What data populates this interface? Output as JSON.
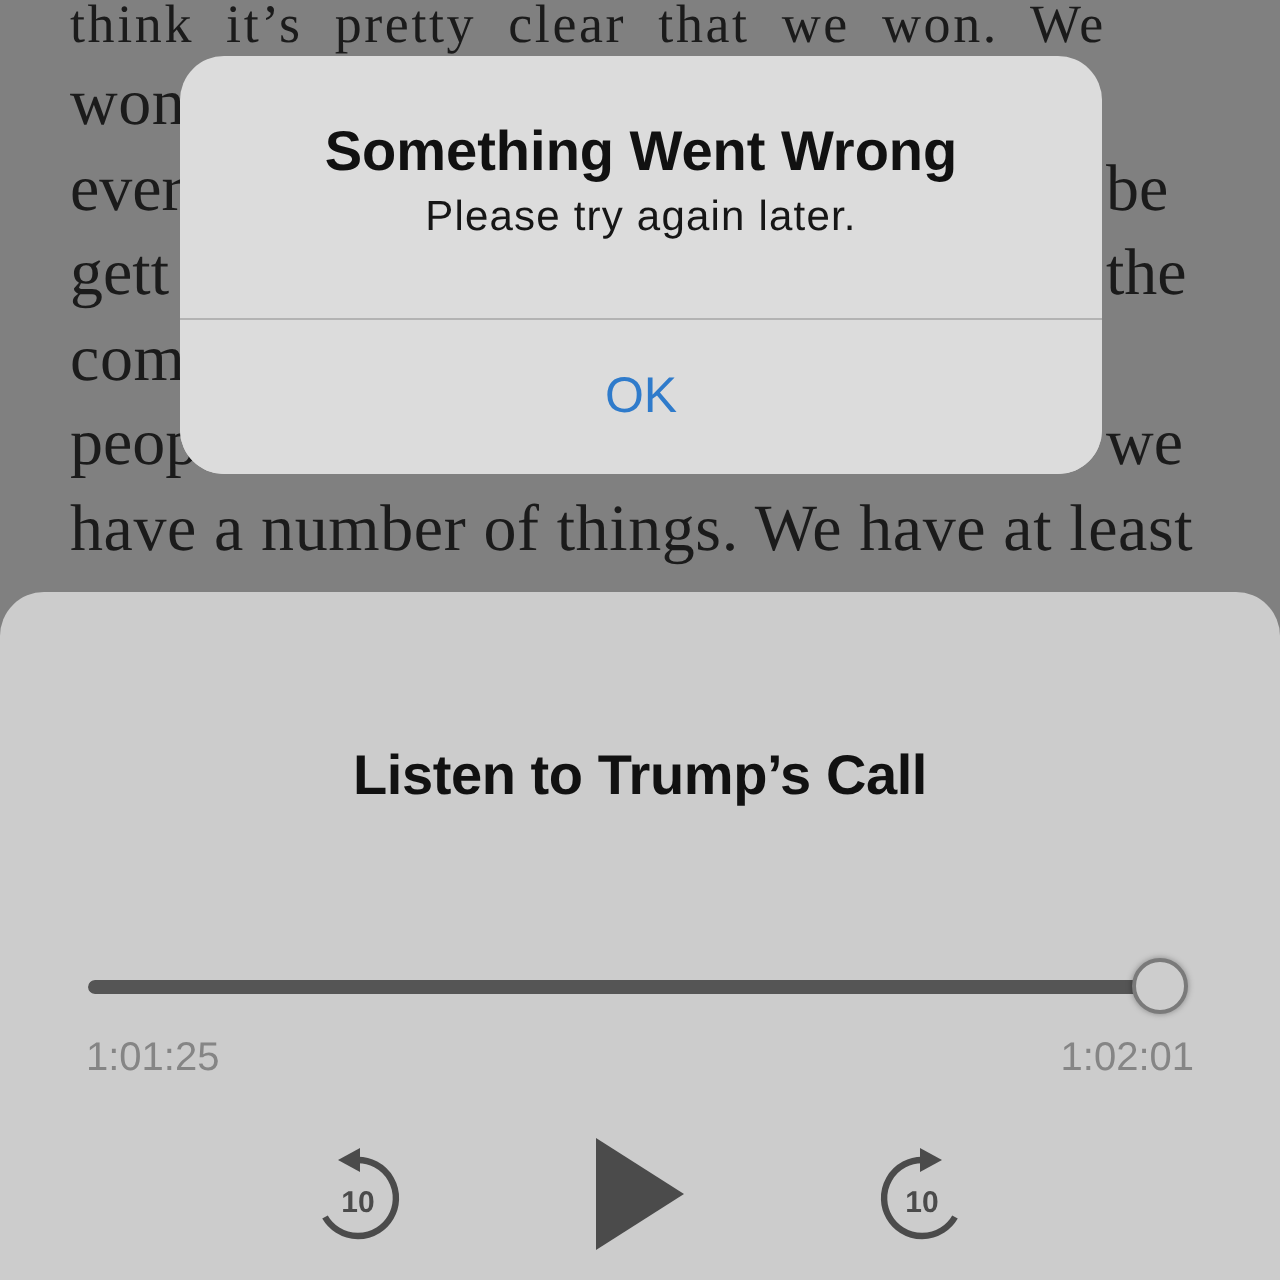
{
  "article": {
    "lines": [
      {
        "left": "think it’s pretty clear that we won. We"
      },
      {
        "left": "won"
      },
      {
        "left": "ever",
        "right": "be"
      },
      {
        "left": "gett",
        "right": "the"
      },
      {
        "left": "com"
      },
      {
        "left": "peop",
        "right": "we"
      },
      {
        "left": "have a number of things. We have at least"
      }
    ]
  },
  "alert": {
    "title": "Something Went Wrong",
    "message": "Please try again later.",
    "buttons": [
      "OK"
    ]
  },
  "player": {
    "title": "Listen to Trump’s Call",
    "progress": {
      "level": 0.99
    },
    "elapsed": "1:01:25",
    "duration": "1:02:01",
    "controls": [
      {
        "kind": "skip_back",
        "label": "10"
      },
      {
        "kind": "play"
      },
      {
        "kind": "skip_forward",
        "label": "10"
      }
    ]
  }
}
